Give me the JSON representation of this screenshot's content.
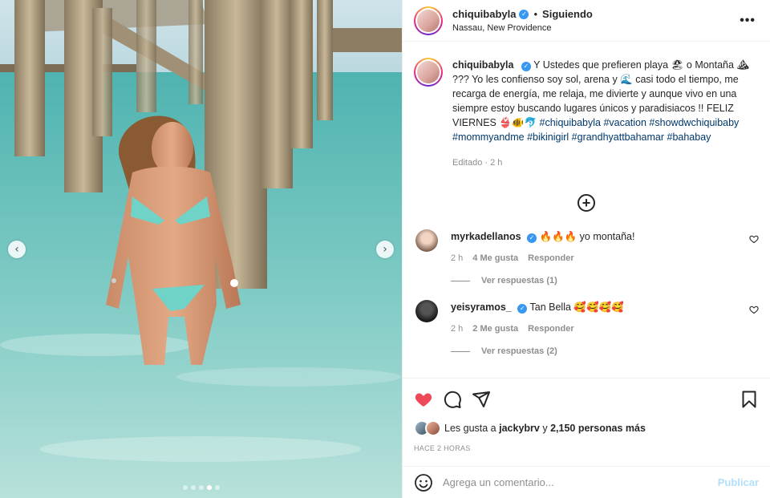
{
  "post": {
    "username": "chiquibabyla",
    "follow_separator": "•",
    "follow_status": "Siguiendo",
    "location": "Nassau, New Providence",
    "more_icon": "more-options-icon",
    "image": {
      "prev_icon": "chevron-left-icon",
      "next_icon": "chevron-right-icon",
      "prev_glyph": "‹",
      "next_glyph": "›",
      "carousel_count": 5,
      "carousel_active_index": 3
    }
  },
  "caption": {
    "username": "chiquibabyla",
    "text": "Y Ustedes que prefieren playa 🏖 o Montaña ⛰ ??? Yo les confienso soy sol, arena y 🌊 casi todo el tiempo, me recarga de energía, me relaja, me divierte y aunque vivo en una siempre estoy buscando lugares únicos y paradisiacos !! FELIZ VIERNES 👙🐠🐬",
    "hashtags": "#chiquibabyla #vacation #showdwchiquibaby #mommyandme #bikinigirl #grandhyattbahamar #bahabay",
    "meta": "Editado · 2 h"
  },
  "comments": [
    {
      "username": "myrkadellanos",
      "text": "🔥🔥🔥 yo montaña!",
      "time": "2 h",
      "likes": "4 Me gusta",
      "reply": "Responder",
      "view_replies": "Ver respuestas (1)"
    },
    {
      "username": "yeisyramos_",
      "text": "Tan Bella 🥰🥰🥰🥰",
      "time": "2 h",
      "likes": "2 Me gusta",
      "reply": "Responder",
      "view_replies": "Ver respuestas (2)"
    }
  ],
  "actions": {
    "liked": true,
    "like_color": "#ed4956",
    "likes_prefix": "Les gusta a",
    "likes_user": "jackybrv",
    "likes_connector": "y",
    "likes_rest": "2,150 personas más",
    "time_ago": "HACE 2 HORAS"
  },
  "add_comment": {
    "placeholder": "Agrega un comentario...",
    "publish_label": "Publicar"
  },
  "colors": {
    "verified": "#3897f0",
    "hashtag": "#00376b",
    "publish_disabled": "#b2dffc"
  }
}
